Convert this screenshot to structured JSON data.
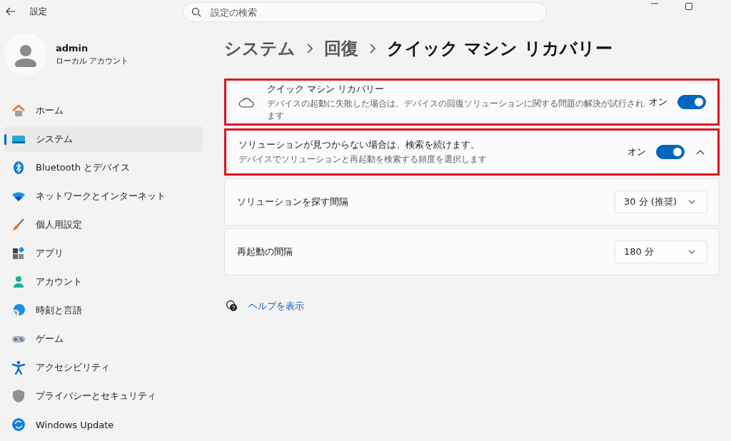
{
  "window": {
    "title": "設定"
  },
  "search": {
    "placeholder": "設定の検索"
  },
  "account": {
    "name": "admin",
    "type": "ローカル アカウント"
  },
  "nav": [
    {
      "label": "ホーム",
      "selected": false
    },
    {
      "label": "システム",
      "selected": true
    },
    {
      "label": "Bluetooth とデバイス",
      "selected": false
    },
    {
      "label": "ネットワークとインターネット",
      "selected": false
    },
    {
      "label": "個人用設定",
      "selected": false
    },
    {
      "label": "アプリ",
      "selected": false
    },
    {
      "label": "アカウント",
      "selected": false
    },
    {
      "label": "時刻と言語",
      "selected": false
    },
    {
      "label": "ゲーム",
      "selected": false
    },
    {
      "label": "アクセシビリティ",
      "selected": false
    },
    {
      "label": "プライバシーとセキュリティ",
      "selected": false
    },
    {
      "label": "Windows Update",
      "selected": false
    }
  ],
  "breadcrumb": [
    {
      "label": "システム",
      "current": false
    },
    {
      "label": "回復",
      "current": false
    },
    {
      "label": "クイック マシン リカバリー",
      "current": true
    }
  ],
  "settings": [
    {
      "kind": "toggle",
      "title": "クイック マシン リカバリー",
      "description": "デバイスの起動に失敗した場合は、デバイスの回復ソリューションに関する問題の解決が試行されます",
      "state_label": "オン",
      "on": true,
      "highlighted": true,
      "has_icon": true
    },
    {
      "kind": "toggle",
      "title": "ソリューションが見つからない場合は、検索を続けます。",
      "description": "デバイスでソリューションと再起動を検索する頻度を選択します",
      "state_label": "オン",
      "on": true,
      "highlighted": true,
      "expanded": true
    },
    {
      "kind": "dropdown",
      "title": "ソリューションを探す間隔",
      "value": "30 分 (推奨)"
    },
    {
      "kind": "dropdown",
      "title": "再起動の間隔",
      "value": "180 分"
    }
  ],
  "help_link": "ヘルプを表示"
}
